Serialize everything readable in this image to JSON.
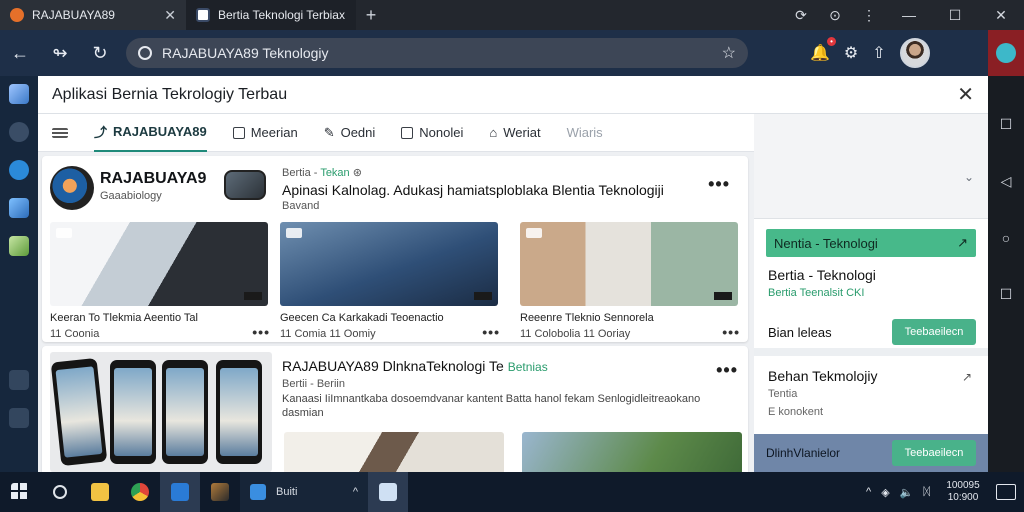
{
  "browser": {
    "tabs": [
      {
        "label": "RAJABUAYA89"
      },
      {
        "label": "Bertia Teknologi Terbiax"
      }
    ],
    "address": "RAJABUAYA89 Teknologiy"
  },
  "panel": {
    "title": "Aplikasi Bernia Tekrologiy Terbau",
    "nav": [
      "RAJABUAYA89",
      "Meerian",
      "Oedni",
      "Nonolei",
      "Weriat",
      "Wiaris"
    ]
  },
  "card1": {
    "channel_name": "RAJABUAYA9",
    "channel_sub": "Gaaabiology",
    "meta_prefix": "Bertia - ",
    "meta_tag": "Tekan",
    "headline": "Apinasi Kalnolag. Adukasj hamiatsploblaka Blentia Teknologiji",
    "subline": "Bavand",
    "videos": [
      {
        "cap1": "Keeran To Tlekmia     Aeentio Tal",
        "cap2": "11 Coonia"
      },
      {
        "cap1": "Geecen Ca Karkakadi      Teoenactio",
        "cap2": "11 Comia       11 Oomiy"
      },
      {
        "cap1": "Reeenre Tleknio          Sennorela",
        "cap2": "11 Colobolia      11 Ooriay"
      }
    ]
  },
  "card2": {
    "title": "RAJABUAYA89 DlnknaTeknologi  Te ",
    "title_tag": "Betnias",
    "meta": "Bertii - Beriin",
    "desc": "Kanaasi IiImnantkaba dosoemdvanar kantent Batta hanol fekam Senlogidleitreaokano dasmian"
  },
  "side": {
    "green_label": "Nentia - Teknologi",
    "title": "Bertia - Teknologi",
    "sub": "Bertia Teenalsit  CKI",
    "row_label": "Bian leleas",
    "btn1": "Teebaeilecn",
    "box2_title": "Behan Tekmolojiy",
    "box2_l1": "Tentia",
    "box2_l2": "E konokent",
    "bar_label": "DlinhVlanielor",
    "btn2": "Teebaeilecn"
  },
  "taskbar": {
    "app_label": "Buiti",
    "clock_line1": "100095",
    "clock_line2": "10:900"
  },
  "colors": {
    "accent": "#47b98a",
    "toolbar": "#1e2f48",
    "taskbar": "#0f1a2a"
  },
  "icons": [
    "back-icon",
    "forward-icon",
    "reload-icon",
    "lock-icon",
    "star-icon",
    "notification-icon",
    "settings-icon",
    "upload-icon"
  ]
}
